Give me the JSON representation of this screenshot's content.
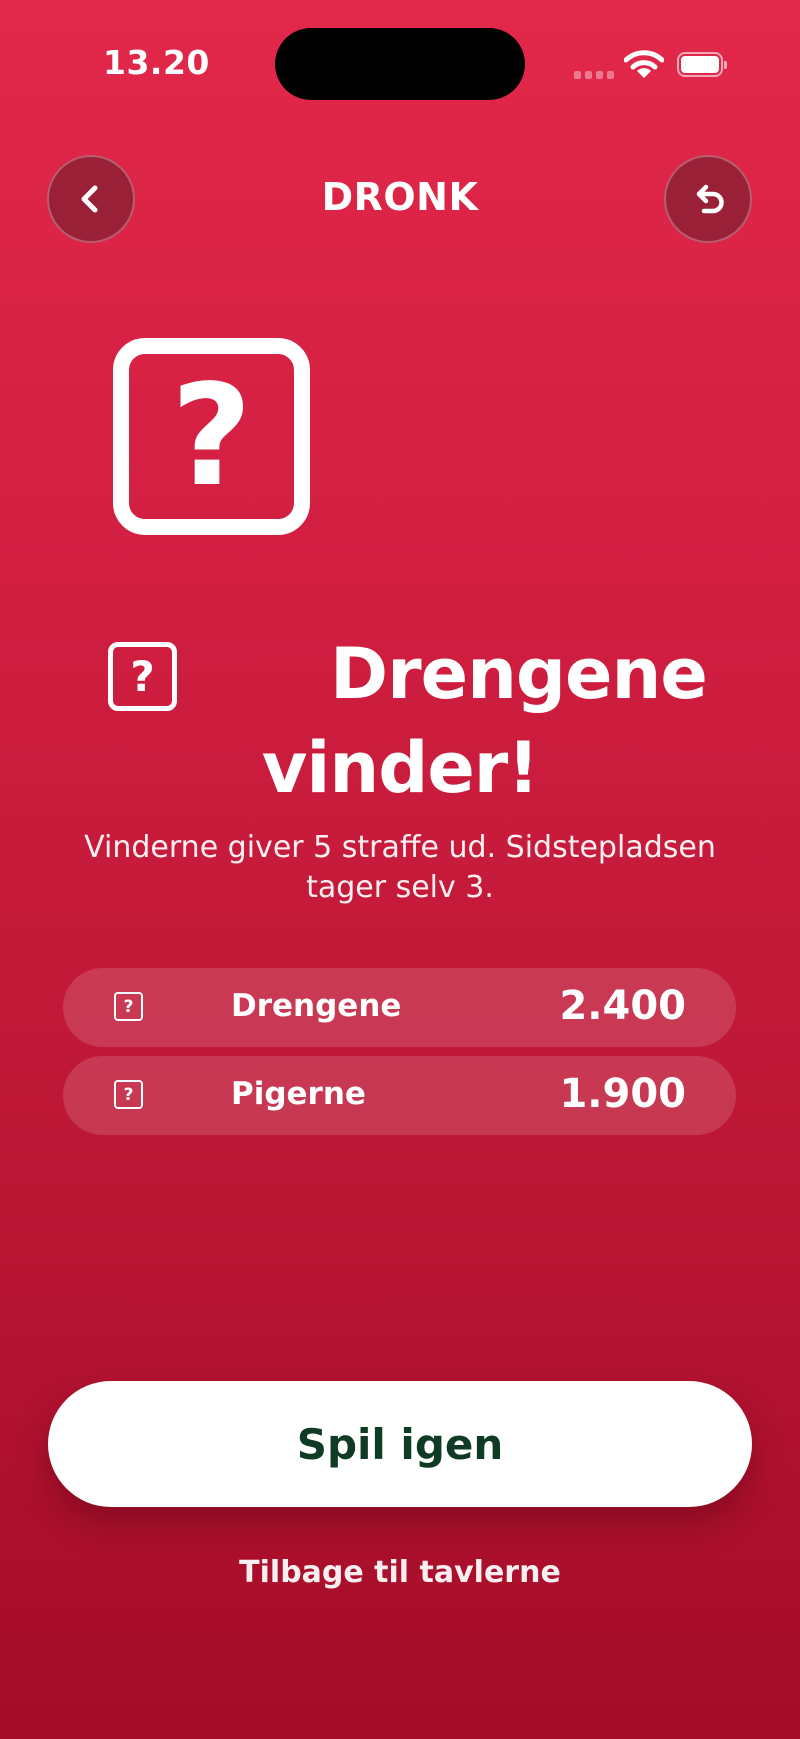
{
  "status_bar": {
    "time": "13.20"
  },
  "header": {
    "title": "DRONK",
    "back_icon": "chevron-left-icon",
    "undo_icon": "undo-arrow-icon"
  },
  "result": {
    "hero_icon_glyph": "?",
    "small_icon_glyph": "?",
    "winner_line1": "Drengene",
    "winner_line2": "vinder!",
    "description": "Vinderne giver 5 straffe ud. Sidstepladsen tager selv 3."
  },
  "scoreboard": [
    {
      "icon_glyph": "?",
      "name": "Drengene",
      "score": "2.400"
    },
    {
      "icon_glyph": "?",
      "name": "Pigerne",
      "score": "1.900"
    }
  ],
  "actions": {
    "play_again_label": "Spil igen",
    "back_to_boards_label": "Tilbage til tavlerne"
  },
  "colors": {
    "background_top": "#e2284a",
    "background_bottom": "#a30c27",
    "primary_button_text": "#0f3b24"
  }
}
